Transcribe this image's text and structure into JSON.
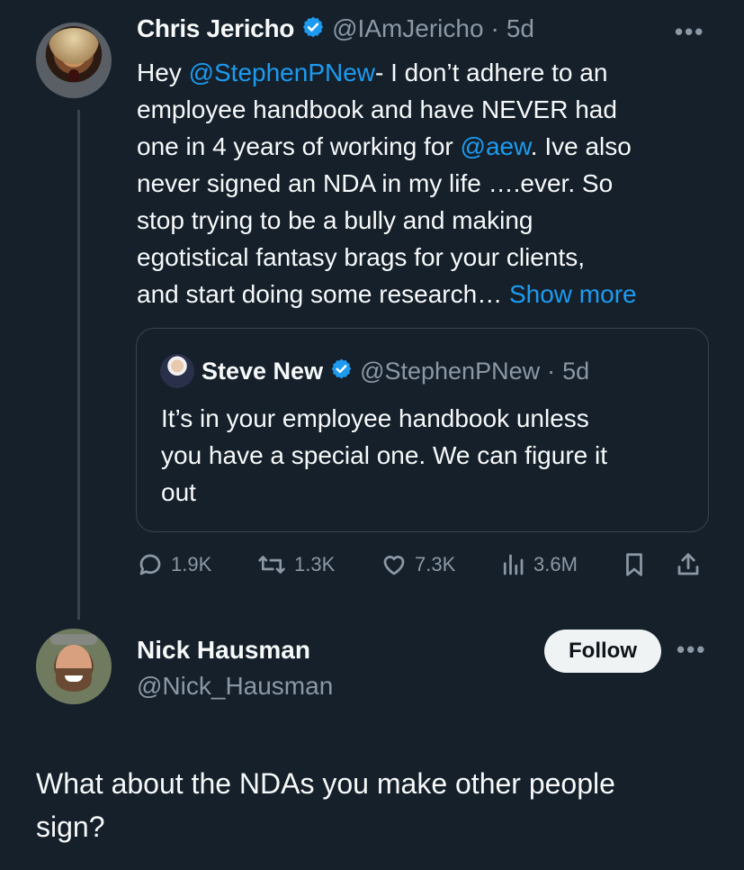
{
  "tweet": {
    "author_name": "Chris Jericho",
    "author_handle": "@IAmJericho",
    "separator": "·",
    "time": "5d",
    "text_lines": [
      {
        "pre": "Hey ",
        "mention": "@StephenPNew",
        "post": "- I don’t adhere to an"
      },
      {
        "pre": "employee handbook and have NEVER had",
        "mention": "",
        "post": ""
      },
      {
        "pre": "one in 4 years of working for ",
        "mention": "@aew",
        "post": ".  Ive also"
      },
      {
        "pre": "never signed an NDA in my life ….ever.  So",
        "mention": "",
        "post": ""
      },
      {
        "pre": "stop trying to be a bully and making",
        "mention": "",
        "post": ""
      },
      {
        "pre": "egotistical fantasy brags for your clients,",
        "mention": "",
        "post": ""
      },
      {
        "pre": "and start doing some research… ",
        "mention": "Show more",
        "post": ""
      }
    ],
    "quote": {
      "author_name": "Steve New",
      "author_handle": "@StephenPNew",
      "separator": "·",
      "time": "5d",
      "text_lines": [
        "It’s in your employee handbook unless",
        "you have a special one.  We can figure it",
        "out"
      ]
    },
    "actions": {
      "replies": "1.9K",
      "retweets": "1.3K",
      "likes": "7.3K",
      "views": "3.6M"
    }
  },
  "reply": {
    "author_name": "Nick Hausman",
    "author_handle": "@Nick_Hausman",
    "follow_label": "Follow",
    "text_lines": [
      "What about the NDAs you make other people",
      "sign?"
    ]
  },
  "colors": {
    "background": "#15202b",
    "accent": "#1d9bf0",
    "muted": "#8b98a5"
  }
}
